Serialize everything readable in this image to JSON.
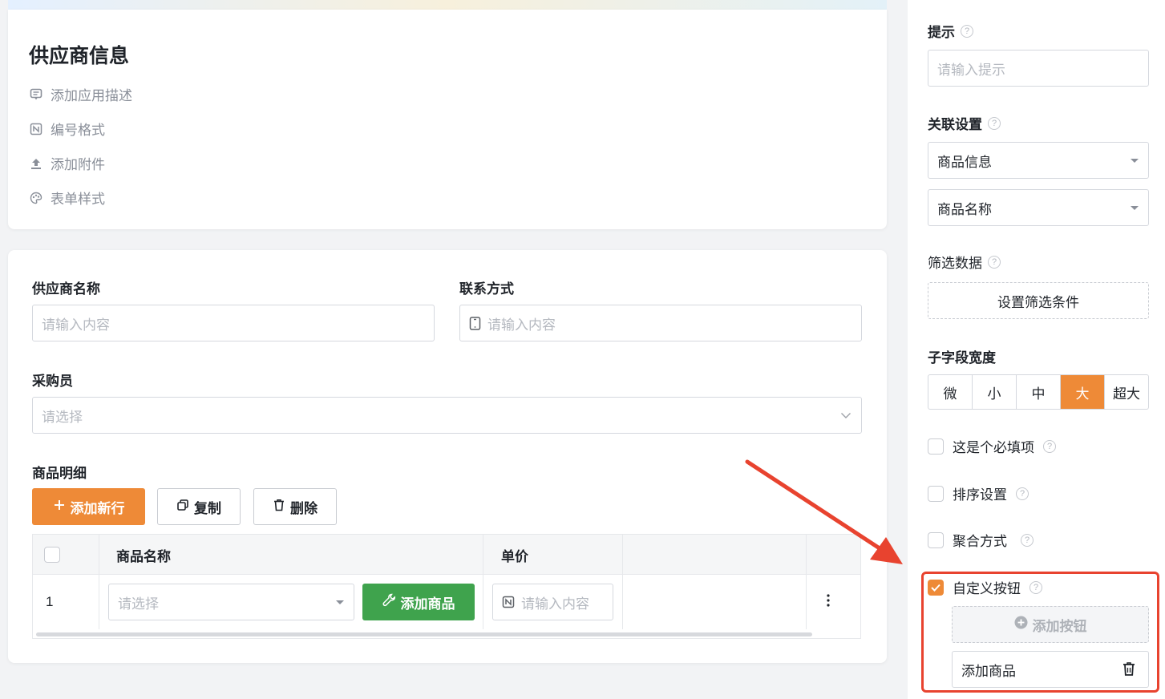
{
  "info": {
    "title": "供应商信息",
    "links": [
      {
        "icon": "comment-icon",
        "label": "添加应用描述"
      },
      {
        "icon": "number-format-icon",
        "label": "编号格式"
      },
      {
        "icon": "upload-icon",
        "label": "添加附件"
      },
      {
        "icon": "palette-icon",
        "label": "表单样式"
      }
    ]
  },
  "form": {
    "supplier_name": {
      "label": "供应商名称",
      "placeholder": "请输入内容"
    },
    "contact": {
      "label": "联系方式",
      "placeholder": "请输入内容"
    },
    "buyer": {
      "label": "采购员",
      "placeholder": "请选择"
    },
    "details": {
      "label": "商品明细",
      "add_row": "添加新行",
      "copy": "复制",
      "delete": "删除",
      "columns": [
        "商品名称",
        "单价"
      ],
      "rows": [
        {
          "index": "1",
          "product_placeholder": "请选择",
          "add_product": "添加商品",
          "price_placeholder": "请输入内容"
        }
      ]
    }
  },
  "panel": {
    "hint": {
      "label": "提示",
      "placeholder": "请输入提示"
    },
    "relation": {
      "label": "关联设置",
      "select1": "商品信息",
      "select2": "商品名称"
    },
    "filter": {
      "label": "筛选数据",
      "button": "设置筛选条件"
    },
    "width": {
      "label": "子字段宽度",
      "options": [
        "微",
        "小",
        "中",
        "大",
        "超大"
      ],
      "selected": "大"
    },
    "required": {
      "label": "这是个必填项",
      "checked": false
    },
    "sort": {
      "label": "排序设置",
      "checked": false
    },
    "aggregate": {
      "label": "聚合方式",
      "checked": false
    },
    "custom_button": {
      "label": "自定义按钮",
      "checked": true,
      "add_button": "添加按钮",
      "item": "添加商品"
    }
  },
  "colors": {
    "accent": "#ee8a37",
    "green": "#3fa34d",
    "annotation": "#e8432f"
  }
}
